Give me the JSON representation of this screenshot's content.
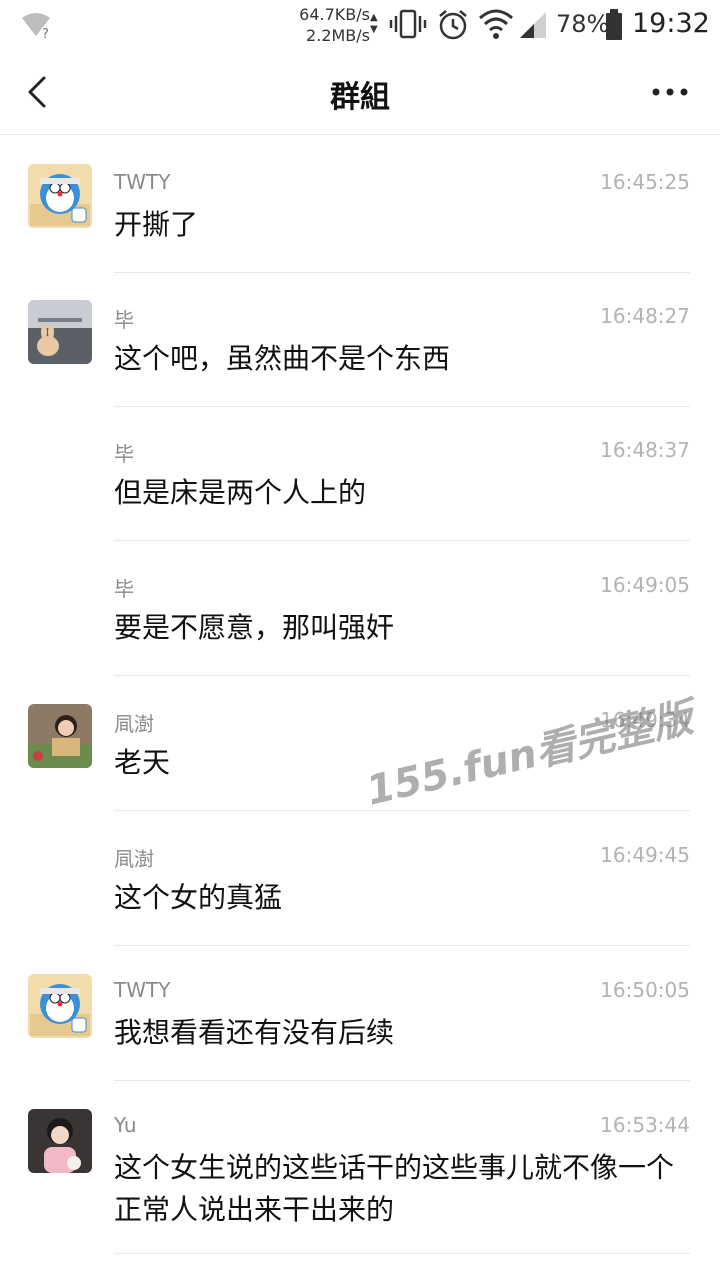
{
  "status_bar": {
    "net_down": "64.7KB/s",
    "net_up": "2.2MB/s",
    "battery": "78%",
    "time": "19:32",
    "icons": [
      "wifi-question-icon",
      "vibrate-icon",
      "alarm-icon",
      "wifi-icon",
      "signal-icon",
      "battery-icon"
    ]
  },
  "header": {
    "title": "群組",
    "back_icon": "chevron-left-icon",
    "more_icon": "more-horizontal-icon"
  },
  "messages": [
    {
      "name": "TWTY",
      "time": "16:45:25",
      "text": "开撕了",
      "avatar": "doraemon"
    },
    {
      "name": "毕",
      "time": "16:48:27",
      "text": "这个吧，虽然曲不是个东西",
      "avatar": "rabbit"
    },
    {
      "name": "毕",
      "time": "16:48:37",
      "text": "但是床是两个人上的",
      "avatar": ""
    },
    {
      "name": "毕",
      "time": "16:49:05",
      "text": "要是不愿意，那叫强奸",
      "avatar": ""
    },
    {
      "name": "凬澍",
      "time": "16:49:34",
      "text": "老天",
      "avatar": "girl-book"
    },
    {
      "name": "凬澍",
      "time": "16:49:45",
      "text": "这个女的真猛",
      "avatar": ""
    },
    {
      "name": "TWTY",
      "time": "16:50:05",
      "text": "我想看看还有没有后续",
      "avatar": "doraemon"
    },
    {
      "name": "Yu",
      "time": "16:53:44",
      "text": "这个女生说的这些话干的这些事儿就不像一个正常人说出来干出来的",
      "avatar": "girl-pink"
    }
  ],
  "watermark": "155.fun看完整版"
}
